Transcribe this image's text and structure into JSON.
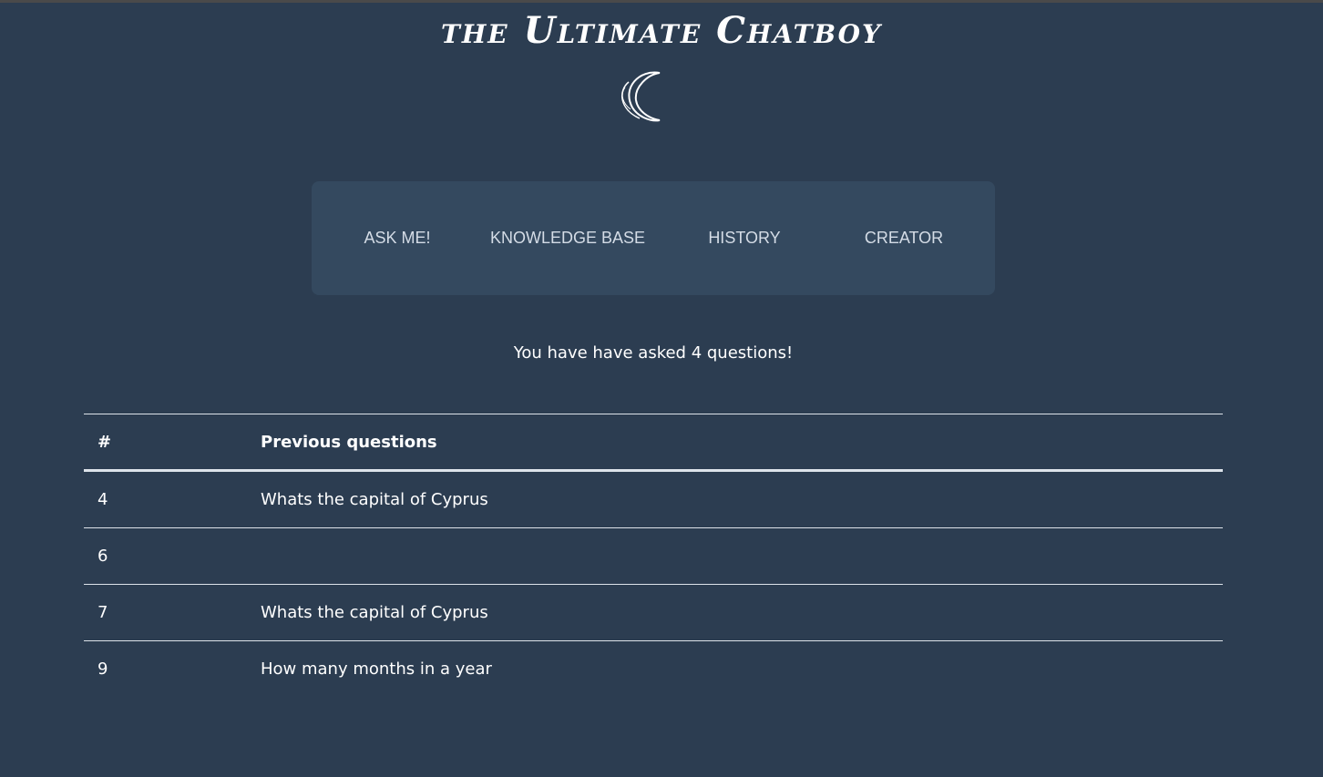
{
  "header": {
    "title": "the Ultimate Chatboy",
    "logo_icon": "crescent-logo-icon"
  },
  "nav": {
    "items": [
      {
        "label": "ASK ME!"
      },
      {
        "label": "KNOWLEDGE BASE"
      },
      {
        "label": "HISTORY"
      },
      {
        "label": "CREATOR"
      }
    ]
  },
  "history": {
    "summary": "You have have asked 4 questions!",
    "columns": [
      "#",
      "Previous questions"
    ],
    "rows": [
      {
        "num": "4",
        "question": "Whats the capital of Cyprus"
      },
      {
        "num": "6",
        "question": ""
      },
      {
        "num": "7",
        "question": "Whats the capital of Cyprus"
      },
      {
        "num": "9",
        "question": "How many months in a year"
      }
    ]
  },
  "colors": {
    "background": "#2c3d51",
    "nav_background": "#34495f",
    "nav_text": "#d4dce6",
    "text": "#ffffff"
  }
}
